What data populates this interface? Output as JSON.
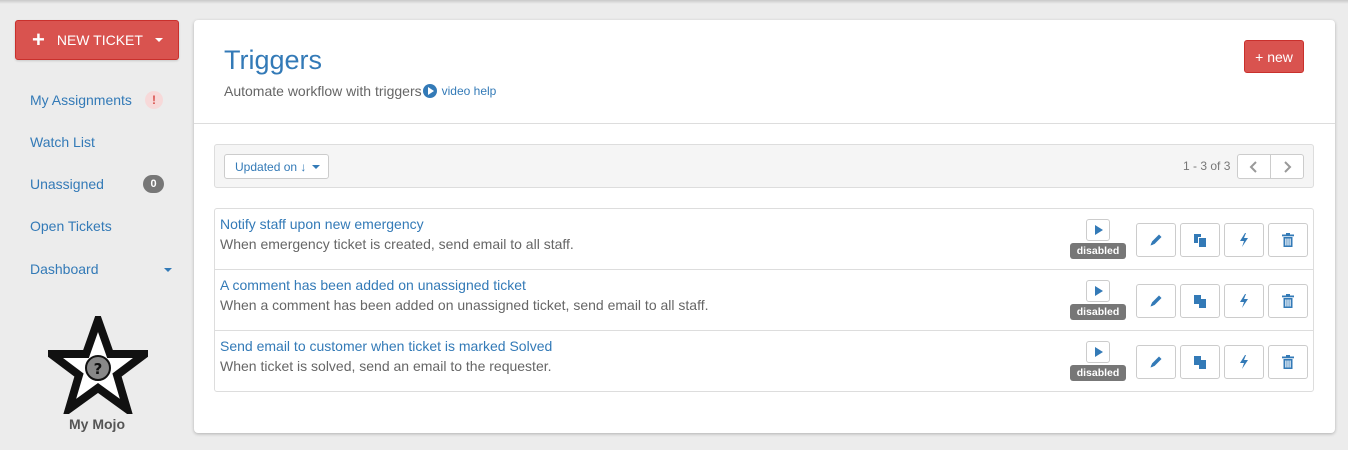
{
  "sidebar": {
    "new_ticket_label": "NEW TICKET",
    "items": [
      {
        "label": "My Assignments",
        "badge": "!"
      },
      {
        "label": "Watch List"
      },
      {
        "label": "Unassigned",
        "badge": "0"
      },
      {
        "label": "Open Tickets"
      },
      {
        "label": "Dashboard"
      }
    ],
    "logo_text": "My Mojo"
  },
  "header": {
    "title": "Triggers",
    "subtitle": "Automate workflow with triggers",
    "video_help": "video help",
    "new_button": "+ new"
  },
  "toolbar": {
    "sort_label": "Updated on ↓",
    "pager_text": "1 - 3 of 3"
  },
  "triggers": [
    {
      "title": "Notify staff upon new emergency",
      "description": "When emergency ticket is created, send email to all staff.",
      "status": "disabled"
    },
    {
      "title": "A comment has been added on unassigned ticket",
      "description": "When a comment has been added on unassigned ticket, send email to all staff.",
      "status": "disabled"
    },
    {
      "title": "Send email to customer when ticket is marked Solved",
      "description": "When ticket is solved, send an email to the requester.",
      "status": "disabled"
    }
  ],
  "colors": {
    "accent": "#337ab7",
    "danger": "#d9534f",
    "badge_gray": "#777777"
  },
  "icons": {
    "run": "play-icon",
    "edit": "pencil-icon",
    "copy": "copy-icon",
    "fire": "lightning-icon",
    "delete": "trash-icon"
  }
}
